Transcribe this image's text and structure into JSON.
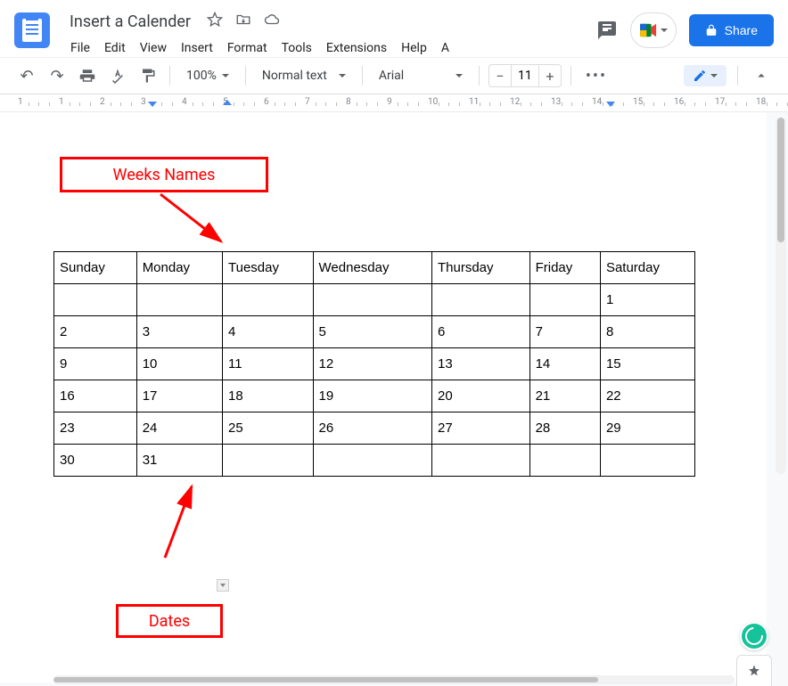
{
  "header": {
    "doc_title": "Insert a Calender",
    "menubar": [
      "File",
      "Edit",
      "View",
      "Insert",
      "Format",
      "Tools",
      "Extensions",
      "Help",
      "A"
    ],
    "share_label": "Share"
  },
  "toolbar": {
    "zoom": "100%",
    "style": "Normal text",
    "font": "Arial",
    "font_size": "11"
  },
  "ruler": {
    "ticks": [
      "1",
      "1",
      "2",
      "3",
      "4",
      "5",
      "6",
      "7",
      "8",
      "9",
      "10",
      "11",
      "12",
      "13",
      "14",
      "15",
      "16",
      "17",
      "18"
    ]
  },
  "annotations": {
    "weeks": "Weeks Names",
    "dates": "Dates"
  },
  "calendar": {
    "headers": [
      "Sunday",
      "Monday",
      "Tuesday",
      "Wednesday",
      "Thursday",
      "Friday",
      "Saturday"
    ],
    "rows": [
      [
        "",
        "",
        "",
        "",
        "",
        "",
        "1"
      ],
      [
        "2",
        "3",
        "4",
        "5",
        "6",
        "7",
        "8"
      ],
      [
        "9",
        "10",
        "11",
        "12",
        "13",
        "14",
        "15"
      ],
      [
        "16",
        "17",
        "18",
        "19",
        "20",
        "21",
        "22"
      ],
      [
        "23",
        "24",
        "25",
        "26",
        "27",
        "28",
        "29"
      ],
      [
        "30",
        "31",
        "",
        "",
        "",
        "",
        ""
      ]
    ]
  }
}
